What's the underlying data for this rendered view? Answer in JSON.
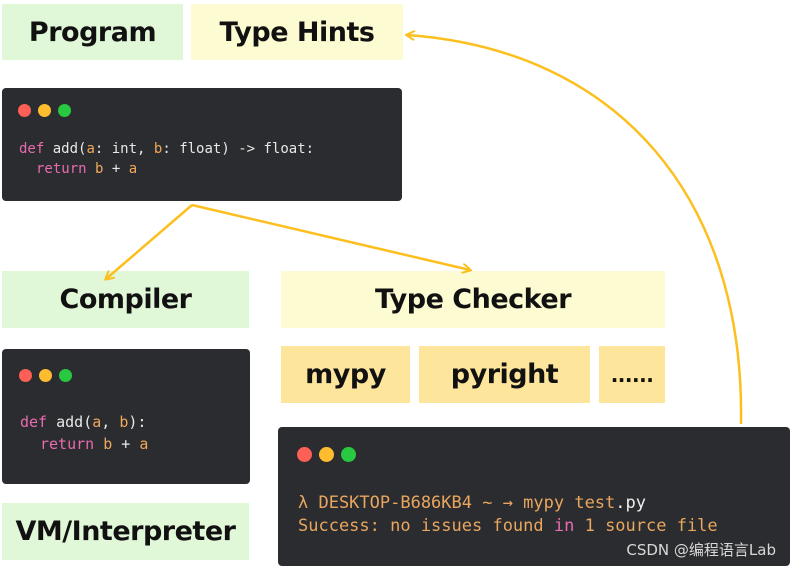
{
  "labels": {
    "program": "Program",
    "type_hints": "Type Hints",
    "compiler": "Compiler",
    "type_checker": "Type Checker",
    "vm": "VM/Interpreter",
    "mypy": "mypy",
    "pyright": "pyright",
    "more": "......"
  },
  "code1": {
    "kw": "def",
    "p1": " add(",
    "a": "a",
    ": int, ": ": int, ",
    "b": "b",
    "rest": ": float) -> float:",
    "ret": "return",
    "sp": " ",
    "b2": "b",
    " + ": " + ",
    "a2": "a"
  },
  "code2": {
    "kw": "def",
    "p1": " add(",
    "a": "a",
    ", ": ", ",
    "b": "b",
    "rest": "):",
    "ret": "return",
    "b2": "b",
    " + ": " + ",
    "a2": "a"
  },
  "terminal": {
    "prompt": "λ DESKTOP-B686KB4 ~ → mypy test",
    "ext": ".py",
    "out1": "Success: no issues found ",
    "in": "in",
    "out2": " 1 source file"
  },
  "watermark": "CSDN @编程语言Lab",
  "colors": {
    "arrow": "#fcbf1e",
    "green": "#e0f8d8",
    "yellow": "#fdfbd2",
    "orange": "#fde59c",
    "code_bg": "#2b2c2f"
  }
}
